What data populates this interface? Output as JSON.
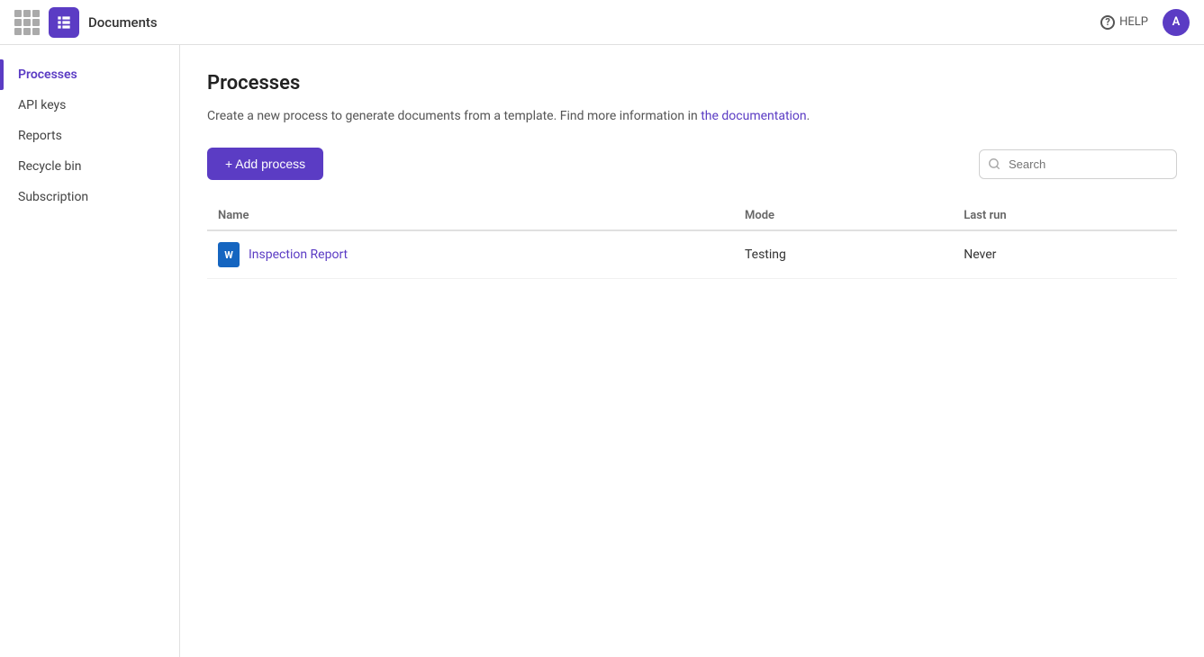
{
  "topbar": {
    "app_name": "Documents",
    "help_label": "HELP",
    "avatar_letter": "A"
  },
  "sidebar": {
    "items": [
      {
        "id": "processes",
        "label": "Processes",
        "active": true
      },
      {
        "id": "api-keys",
        "label": "API keys",
        "active": false
      },
      {
        "id": "reports",
        "label": "Reports",
        "active": false
      },
      {
        "id": "recycle-bin",
        "label": "Recycle bin",
        "active": false
      },
      {
        "id": "subscription",
        "label": "Subscription",
        "active": false
      }
    ]
  },
  "main": {
    "page_title": "Processes",
    "description_text": "Create a new process to generate documents from a template. Find more information in ",
    "doc_link_text": "the documentation",
    "description_end": ".",
    "add_button_label": "+ Add process",
    "search_placeholder": "Search",
    "table": {
      "columns": [
        {
          "id": "name",
          "label": "Name"
        },
        {
          "id": "mode",
          "label": "Mode"
        },
        {
          "id": "last_run",
          "label": "Last run"
        }
      ],
      "rows": [
        {
          "name": "Inspection Report",
          "mode": "Testing",
          "last_run": "Never"
        }
      ]
    }
  }
}
